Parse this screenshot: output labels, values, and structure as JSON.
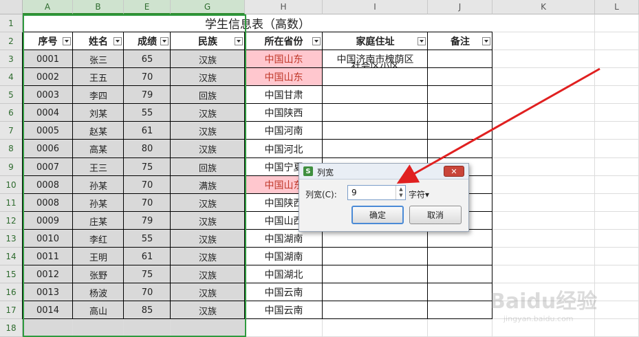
{
  "columns": [
    "A",
    "B",
    "E",
    "G",
    "H",
    "I",
    "J",
    "K",
    "L"
  ],
  "rows": [
    "1",
    "2",
    "3",
    "4",
    "5",
    "6",
    "7",
    "8",
    "9",
    "10",
    "11",
    "12",
    "13",
    "14",
    "15",
    "16",
    "17",
    "18"
  ],
  "table": {
    "title": "学生信息表（高数）",
    "headers": [
      "序号",
      "姓名",
      "成绩",
      "民族",
      "所在省份",
      "家庭住址",
      "备注"
    ],
    "records": [
      [
        "0001",
        "张三",
        "65",
        "汉族",
        "中国山东",
        "中国济南市槐荫区",
        ""
      ],
      [
        "0002",
        "王五",
        "70",
        "汉族",
        "中国山东",
        "",
        ""
      ],
      [
        "0003",
        "李四",
        "79",
        "回族",
        "中国甘肃",
        "",
        ""
      ],
      [
        "0004",
        "刘某",
        "55",
        "汉族",
        "中国陕西",
        "",
        ""
      ],
      [
        "0005",
        "赵某",
        "61",
        "汉族",
        "中国河南",
        "",
        ""
      ],
      [
        "0006",
        "高某",
        "80",
        "汉族",
        "中国河北",
        "",
        ""
      ],
      [
        "0007",
        "王三",
        "75",
        "回族",
        "中国宁夏",
        "",
        ""
      ],
      [
        "0008",
        "孙某",
        "70",
        "满族",
        "中国山东",
        "",
        ""
      ],
      [
        "0008",
        "孙某",
        "70",
        "汉族",
        "中国陕西",
        "",
        ""
      ],
      [
        "0009",
        "庄某",
        "79",
        "汉族",
        "中国山西",
        "",
        ""
      ],
      [
        "0010",
        "李红",
        "55",
        "汉族",
        "中国湖南",
        "",
        ""
      ],
      [
        "0011",
        "王明",
        "61",
        "汉族",
        "中国湖南",
        "",
        ""
      ],
      [
        "0012",
        "张野",
        "75",
        "汉族",
        "中国湖北",
        "",
        ""
      ],
      [
        "0013",
        "杨波",
        "70",
        "汉族",
        "中国云南",
        "",
        ""
      ],
      [
        "0014",
        "高山",
        "85",
        "汉族",
        "中国云南",
        "",
        ""
      ]
    ],
    "overflow_text": "社会区小区"
  },
  "dialog": {
    "icon": "S",
    "title": "列宽",
    "close": "✕",
    "label": "列宽(C):",
    "value": "9",
    "spin_up": "▲",
    "spin_down": "▼",
    "unit": "字符▾",
    "ok": "确定",
    "cancel": "取消"
  },
  "colors": {
    "highlight": "#ffc7ce",
    "highlight_text": "#c0392b",
    "selected_fill": "#d9d9d9",
    "arrow": "#e02020",
    "selection_border": "#2e9a3e"
  },
  "watermark": {
    "brand": "Baidu经验",
    "url": "jingyan.baidu.com"
  }
}
